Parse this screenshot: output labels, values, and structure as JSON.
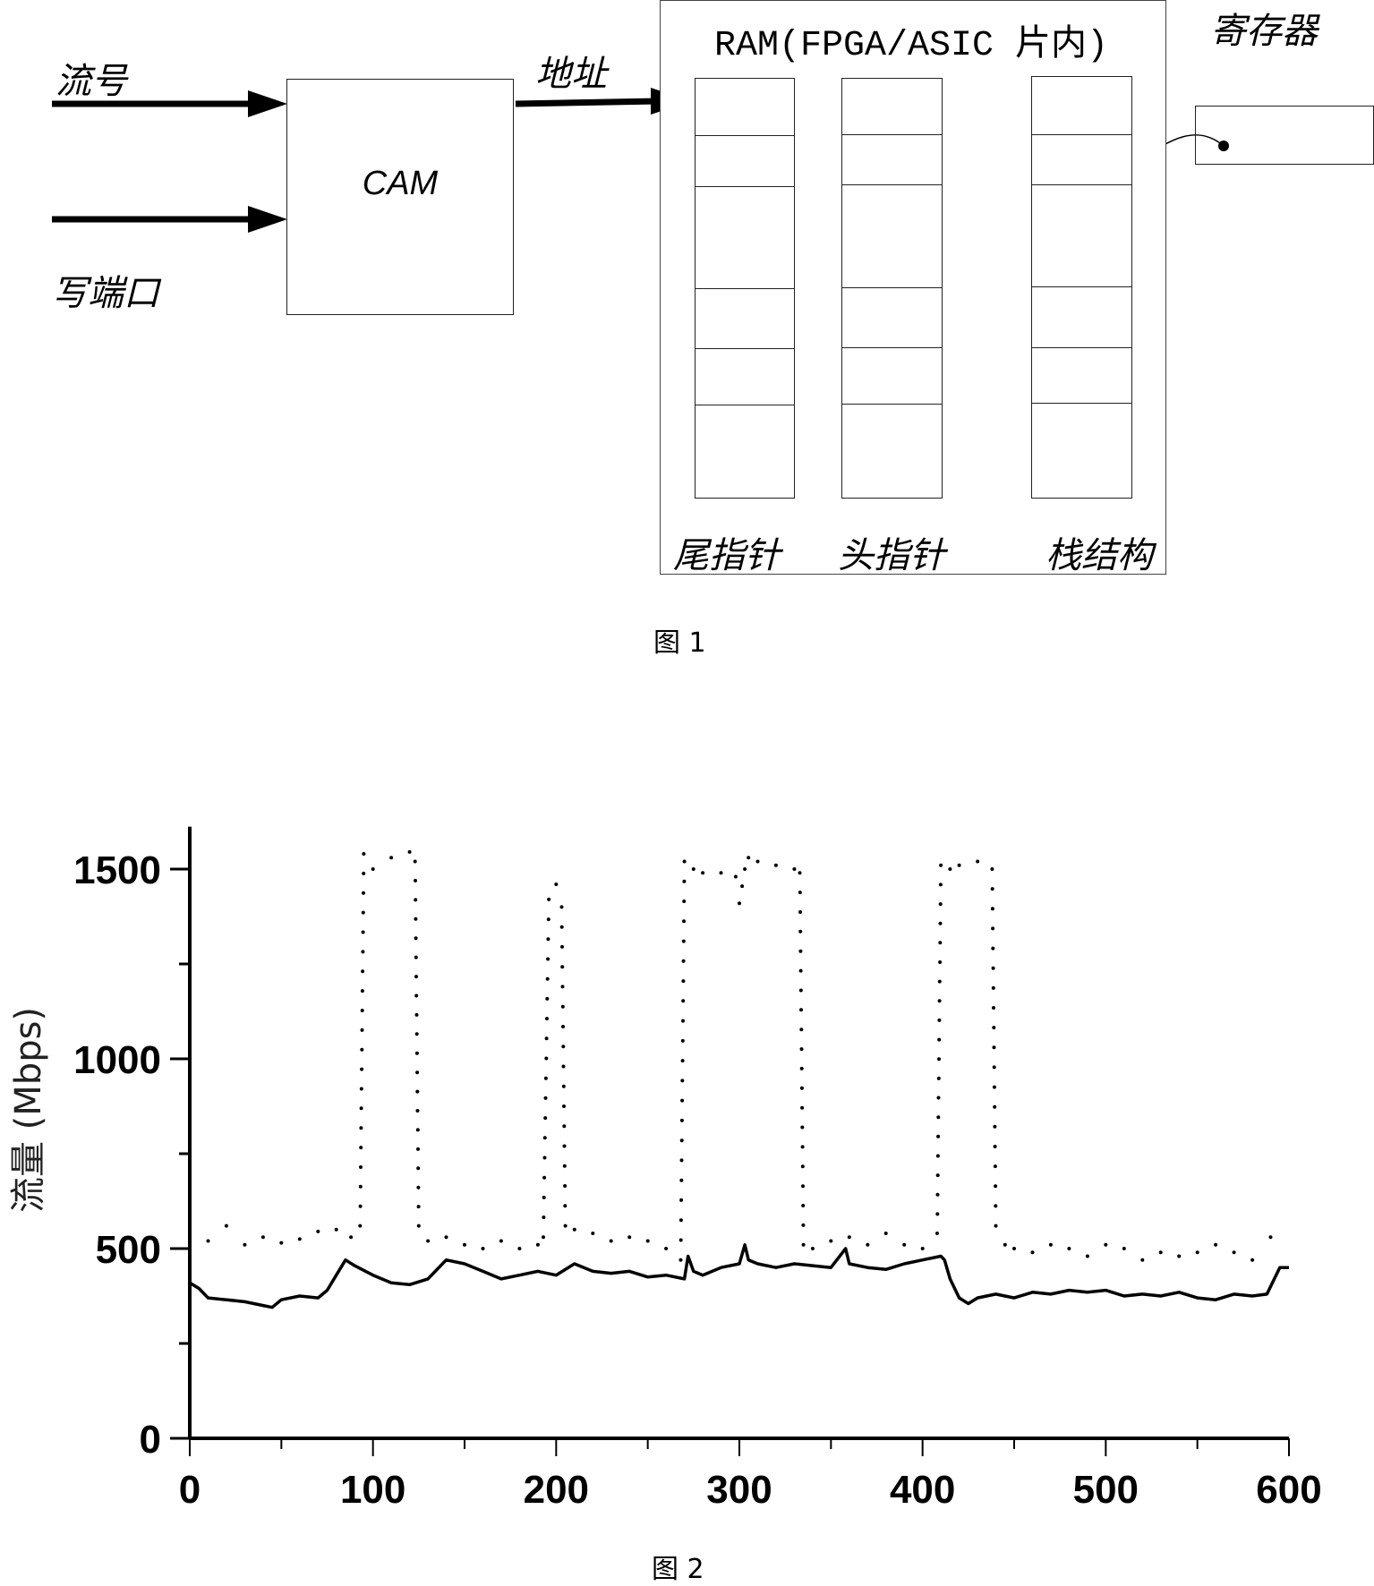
{
  "figure1": {
    "caption": "图 1",
    "inputs": {
      "flow_id": "流号",
      "write_port": "写端口"
    },
    "cam_label": "CAM",
    "address_label": "地址",
    "ram_title": "RAM(FPGA/ASIC 片内)",
    "register_label": "寄存器",
    "columns": [
      {
        "label": "尾指针"
      },
      {
        "label": "头指针"
      },
      {
        "label": "栈结构"
      }
    ]
  },
  "figure2": {
    "caption": "图 2"
  },
  "chart_data": {
    "type": "line",
    "title": "",
    "xlabel": "",
    "ylabel": "流量 (Mbps)",
    "xlim": [
      0,
      600
    ],
    "ylim": [
      0,
      1600
    ],
    "x_ticks": [
      "0",
      "100",
      "200",
      "300",
      "400",
      "500",
      "600"
    ],
    "y_ticks": [
      "0",
      "500",
      "1000",
      "1500"
    ],
    "grid": false,
    "series": [
      {
        "name": "dotted",
        "style": "dotted",
        "x": [
          0,
          10,
          20,
          30,
          40,
          50,
          60,
          70,
          80,
          88,
          93,
          95,
          100,
          110,
          120,
          123,
          125,
          130,
          140,
          150,
          160,
          170,
          180,
          190,
          193,
          196,
          200,
          203,
          205,
          210,
          220,
          230,
          240,
          250,
          260,
          268,
          270,
          275,
          280,
          290,
          298,
          300,
          303,
          305,
          310,
          320,
          330,
          333,
          335,
          340,
          350,
          360,
          370,
          380,
          390,
          400,
          408,
          410,
          415,
          420,
          430,
          438,
          440,
          445,
          450,
          460,
          470,
          480,
          490,
          500,
          510,
          520,
          530,
          540,
          550,
          560,
          570,
          580,
          590,
          600
        ],
        "y": [
          540,
          520,
          560,
          510,
          530,
          515,
          525,
          545,
          550,
          530,
          560,
          1540,
          1500,
          1530,
          1545,
          1520,
          560,
          520,
          530,
          510,
          500,
          520,
          500,
          510,
          530,
          1420,
          1460,
          1400,
          560,
          550,
          540,
          520,
          530,
          520,
          500,
          470,
          1520,
          1500,
          1490,
          1490,
          1480,
          1410,
          1500,
          1530,
          1520,
          1510,
          1500,
          1490,
          510,
          500,
          520,
          530,
          510,
          540,
          510,
          500,
          540,
          1510,
          1500,
          1510,
          1520,
          1500,
          560,
          510,
          500,
          490,
          510,
          500,
          480,
          510,
          500,
          470,
          490,
          480,
          490,
          510,
          490,
          470,
          530,
          500
        ]
      },
      {
        "name": "solid",
        "style": "solid",
        "x": [
          0,
          5,
          10,
          20,
          30,
          40,
          45,
          50,
          60,
          70,
          75,
          80,
          85,
          90,
          100,
          110,
          120,
          130,
          140,
          150,
          160,
          170,
          180,
          190,
          200,
          210,
          220,
          230,
          240,
          250,
          260,
          270,
          272,
          275,
          280,
          290,
          300,
          303,
          305,
          310,
          320,
          330,
          340,
          350,
          358,
          360,
          370,
          380,
          390,
          400,
          410,
          412,
          415,
          420,
          425,
          430,
          440,
          450,
          460,
          470,
          480,
          490,
          500,
          510,
          520,
          530,
          540,
          550,
          560,
          570,
          580,
          588,
          590,
          595,
          600
        ],
        "y": [
          410,
          395,
          370,
          365,
          360,
          350,
          345,
          365,
          375,
          370,
          390,
          430,
          470,
          455,
          430,
          410,
          405,
          420,
          470,
          460,
          440,
          420,
          430,
          440,
          430,
          460,
          440,
          435,
          440,
          425,
          430,
          420,
          480,
          440,
          430,
          450,
          460,
          510,
          470,
          460,
          450,
          460,
          455,
          450,
          500,
          460,
          450,
          445,
          460,
          470,
          480,
          470,
          420,
          370,
          355,
          370,
          380,
          370,
          385,
          380,
          390,
          385,
          390,
          375,
          380,
          375,
          385,
          370,
          365,
          380,
          375,
          380,
          400,
          450,
          450
        ]
      }
    ]
  }
}
